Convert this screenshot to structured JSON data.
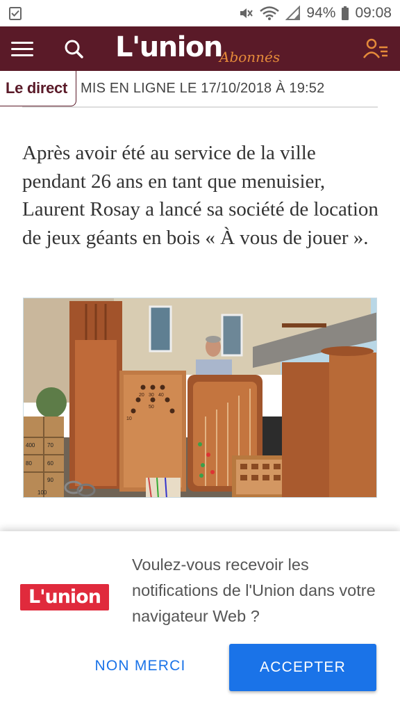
{
  "status_bar": {
    "battery": "94%",
    "time": "09:08",
    "icons": [
      "task-done-icon",
      "mute-icon",
      "wifi-icon",
      "signal-icon",
      "battery-icon"
    ]
  },
  "header": {
    "logo_text": "L'union",
    "logo_sub": "Abonnés",
    "background": "#5a1a28",
    "accent": "#e58a3a",
    "icons": [
      "menu-icon",
      "search-icon",
      "account-icon"
    ]
  },
  "article": {
    "live_tab": "Le direct",
    "published": "MIS EN LIGNE LE 17/10/2018 À 19:52",
    "lead": "Après avoir été au service de la ville pendant 26 ans en tant que menuisier, Laurent Rosay a lancé sa société de location de jeux géants en bois « À vous de jouer ».",
    "photo_numbers": [
      "20",
      "30",
      "40",
      "50",
      "10",
      "400",
      "60",
      "70",
      "80",
      "90",
      "100"
    ]
  },
  "notification_prompt": {
    "logo_text": "L'union",
    "message": "Voulez-vous recevoir les notifications de l'Union dans votre navigateur Web ?",
    "decline_label": "NON MERCI",
    "accept_label": "ACCEPTER",
    "accent": "#1a73e8",
    "logo_color": "#e02a3c"
  }
}
